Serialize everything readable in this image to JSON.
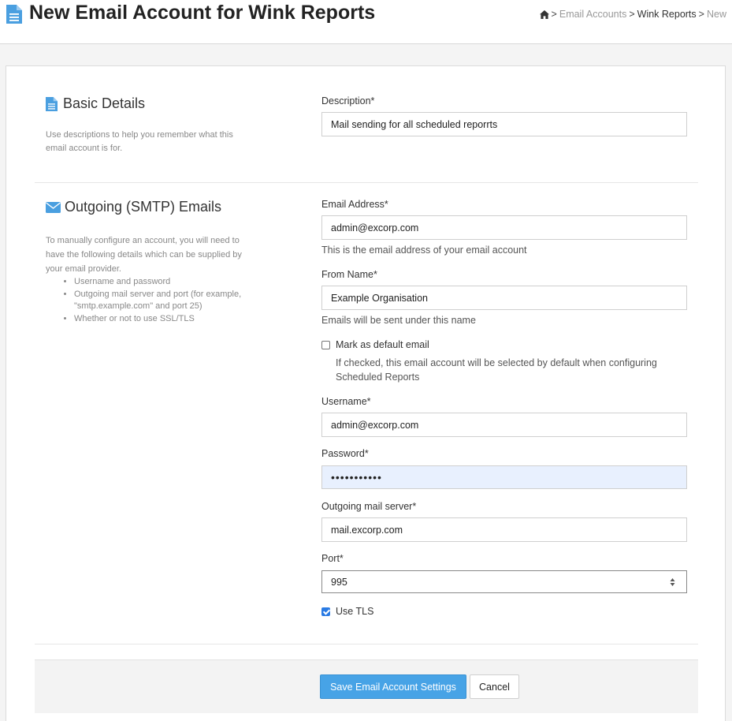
{
  "header": {
    "title": "New Email Account for Wink Reports",
    "breadcrumb": {
      "sep": ">",
      "items": [
        "Email Accounts",
        "Wink Reports",
        "New"
      ]
    }
  },
  "basic": {
    "title": "Basic Details",
    "description": "Use descriptions to help you remember what this email account is for.",
    "description_label": "Description*",
    "description_value": "Mail sending for all scheduled reporrts"
  },
  "smtp": {
    "title": "Outgoing (SMTP) Emails",
    "intro": "To manually configure an account, you will need to have the following details which can be supplied by your email provider.",
    "bullets": [
      "Username and password",
      "Outgoing mail server and port (for example, \"smtp.example.com\" and port 25)",
      "Whether or not to use SSL/TLS"
    ],
    "email_label": "Email Address*",
    "email_value": "admin@excorp.com",
    "email_help": "This is the email address of your email account",
    "from_label": "From Name*",
    "from_value": "Example Organisation",
    "from_help": "Emails will be sent under this name",
    "default_label": "Mark as default email",
    "default_checked": false,
    "default_help_1": "If checked, this email account will be selected by default when configuring",
    "default_help_2": "Scheduled Reports",
    "username_label": "Username*",
    "username_value": "admin@excorp.com",
    "password_label": "Password*",
    "password_value": "•••••••••••",
    "server_label": "Outgoing mail server*",
    "server_value": "mail.excorp.com",
    "port_label": "Port*",
    "port_value": "995",
    "tls_label": "Use TLS",
    "tls_checked": true
  },
  "buttons": {
    "save": "Save Email Account Settings",
    "cancel": "Cancel"
  },
  "colors": {
    "accent": "#47a3e6",
    "icon": "#4a9fe0",
    "autofill": "#e8f0fe"
  },
  "icons": [
    "document-icon",
    "home-icon",
    "envelope-icon",
    "spinner-arrows-icon"
  ]
}
